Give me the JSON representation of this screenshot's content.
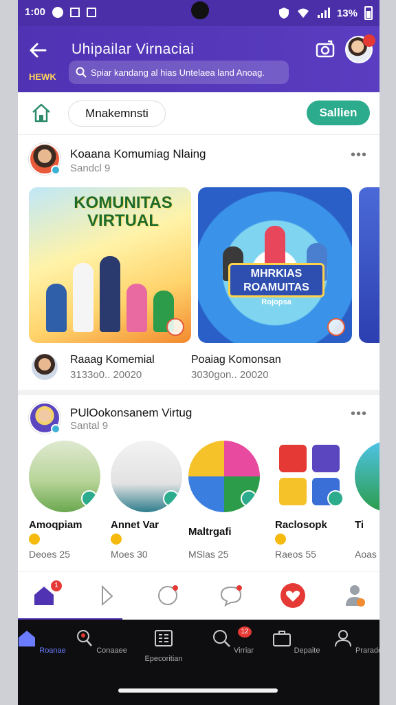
{
  "status": {
    "time": "1:00",
    "battery": "13%"
  },
  "header": {
    "title": "Uhipailar Virnaciai",
    "subtitle": "HEWK",
    "search_placeholder": "Spiar kandang al hias Untelaea land Anoag."
  },
  "toolbar": {
    "chip_label": "Mnakemnsti",
    "save_label": "Sallien"
  },
  "post1": {
    "author": "Koaana Komumiag Nlaing",
    "time": "Sandcl 9",
    "cards": [
      {
        "banner": "KOMUNITAS VIRTUAL"
      },
      {
        "banner": "MHRKIAS ROAMUITAS",
        "sub": "Rojopsa"
      }
    ],
    "captions": [
      {
        "title": "Raaag Komemial",
        "date": "3133o0.. 20020"
      },
      {
        "title": "Poaiag Komonsan",
        "date": "3030gon.. 20020"
      }
    ]
  },
  "post2": {
    "author": "PUlOokonsanem Virtug",
    "time": "Santal 9",
    "items": [
      {
        "label": "Amoqpiam",
        "count": "Deoes 25"
      },
      {
        "label": "Annet Var",
        "count": "Moes 30"
      },
      {
        "label": "Maltrgafi",
        "count": "MSlas 25"
      },
      {
        "label": "Raclosopk",
        "count": "Raeos 55"
      },
      {
        "label": "Ti",
        "count": "Aoas"
      }
    ]
  },
  "tabbar_light": {
    "home_badge": "1"
  },
  "navbar": {
    "items": [
      {
        "label": "Roanae",
        "icon": "home-icon"
      },
      {
        "label": "Conaaee",
        "icon": "search-person-icon"
      },
      {
        "label": "Epecoritian",
        "icon": "list-icon"
      },
      {
        "label": "Virriar",
        "icon": "search-icon",
        "badge": "12"
      },
      {
        "label": "Depaite",
        "icon": "briefcase-icon"
      },
      {
        "label": "Prarade",
        "icon": "profile-icon"
      }
    ]
  },
  "colors": {
    "primary": "#4f33b3",
    "accent": "#2cab8d",
    "badge": "#e53935"
  }
}
